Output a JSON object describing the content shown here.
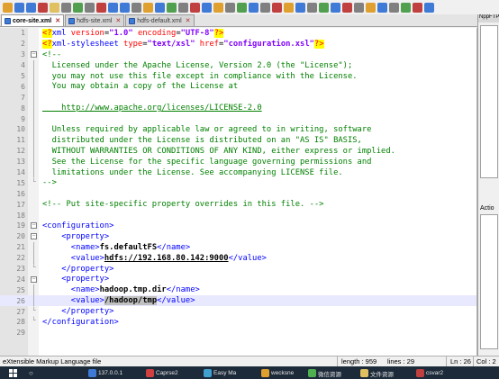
{
  "tabs": [
    {
      "label": "core-site.xml",
      "active": true
    },
    {
      "label": "hdfs-site.xml",
      "active": false
    },
    {
      "label": "hdfs-default.xml",
      "active": false
    }
  ],
  "right_panel": {
    "title": "NppFTP",
    "action_label": "Actio"
  },
  "editor": {
    "current_line": 26,
    "lines": [
      {
        "n": "1",
        "fold": "",
        "html": "<span class=\"pi\">&lt;?</span><span class=\"tag\">xml</span> <span class=\"attr\">version</span>=<span class=\"str\">\"1.0\"</span> <span class=\"attr\">encoding</span>=<span class=\"str\">\"UTF-8\"</span><span class=\"pi\">?&gt;</span>"
      },
      {
        "n": "2",
        "fold": "",
        "html": "<span class=\"pi\">&lt;?</span><span class=\"tag\">xml-stylesheet</span> <span class=\"attr\">type</span>=<span class=\"str\">\"text/xsl\"</span> <span class=\"attr\">href</span>=<span class=\"str\">\"configuration.xsl\"</span><span class=\"pi\">?&gt;</span>"
      },
      {
        "n": "3",
        "fold": "box",
        "html": "<span class=\"cmt\">&lt;!--</span>"
      },
      {
        "n": "4",
        "fold": "bar",
        "html": "<span class=\"cmt\">  Licensed under the Apache License, Version 2.0 (the \"License\");</span>"
      },
      {
        "n": "5",
        "fold": "bar",
        "html": "<span class=\"cmt\">  you may not use this file except in compliance with the License.</span>"
      },
      {
        "n": "6",
        "fold": "bar",
        "html": "<span class=\"cmt\">  You may obtain a copy of the License at</span>"
      },
      {
        "n": "7",
        "fold": "bar",
        "html": ""
      },
      {
        "n": "8",
        "fold": "bar",
        "html": "<span class=\"url\">    http://www.apache.org/licenses/LICENSE-2.0</span>"
      },
      {
        "n": "9",
        "fold": "bar",
        "html": ""
      },
      {
        "n": "10",
        "fold": "bar",
        "html": "<span class=\"cmt\">  Unless required by applicable law or agreed to in writing, software</span>"
      },
      {
        "n": "11",
        "fold": "bar",
        "html": "<span class=\"cmt\">  distributed under the License is distributed on an \"AS IS\" BASIS,</span>"
      },
      {
        "n": "12",
        "fold": "bar",
        "html": "<span class=\"cmt\">  WITHOUT WARRANTIES OR CONDITIONS OF ANY KIND, either express or implied.</span>"
      },
      {
        "n": "13",
        "fold": "bar",
        "html": "<span class=\"cmt\">  See the License for the specific language governing permissions and</span>"
      },
      {
        "n": "14",
        "fold": "bar",
        "html": "<span class=\"cmt\">  limitations under the License. See accompanying LICENSE file.</span>"
      },
      {
        "n": "15",
        "fold": "end",
        "html": "<span class=\"cmt\">--&gt;</span>"
      },
      {
        "n": "16",
        "fold": "",
        "html": ""
      },
      {
        "n": "17",
        "fold": "",
        "html": "<span class=\"cmt\">&lt;!-- Put site-specific property overrides in this file. --&gt;</span>"
      },
      {
        "n": "18",
        "fold": "",
        "html": ""
      },
      {
        "n": "19",
        "fold": "box",
        "html": "<span class=\"tag\">&lt;configuration&gt;</span>"
      },
      {
        "n": "20",
        "fold": "box",
        "html": "    <span class=\"tag\">&lt;property&gt;</span>"
      },
      {
        "n": "21",
        "fold": "bar",
        "html": "      <span class=\"tag\">&lt;name&gt;</span><span class=\"bold\">fs.defaultFS</span><span class=\"tag\">&lt;/name&gt;</span>"
      },
      {
        "n": "22",
        "fold": "bar",
        "html": "      <span class=\"tag\">&lt;value&gt;</span><span class=\"bold\" style=\"text-decoration:underline\">hdfs://192.168.80.142:9000</span><span class=\"tag\">&lt;/value&gt;</span>"
      },
      {
        "n": "23",
        "fold": "end",
        "html": "    <span class=\"tag\">&lt;/property&gt;</span>"
      },
      {
        "n": "24",
        "fold": "box",
        "html": "    <span class=\"tag\">&lt;property&gt;</span>"
      },
      {
        "n": "25",
        "fold": "bar",
        "html": "      <span class=\"tag\">&lt;name&gt;</span><span class=\"bold\">hadoop.tmp.dir</span><span class=\"tag\">&lt;/name&gt;</span>"
      },
      {
        "n": "26",
        "fold": "bar",
        "html": "      <span class=\"tag\">&lt;value&gt;</span><span class=\"bold sel\">/hadoop/tmp</span><span class=\"tag\">&lt;/value&gt;</span>"
      },
      {
        "n": "27",
        "fold": "end",
        "html": "    <span class=\"tag\">&lt;/property&gt;</span>"
      },
      {
        "n": "28",
        "fold": "end",
        "html": "<span class=\"tag\">&lt;/configuration&gt;</span>"
      },
      {
        "n": "29",
        "fold": "",
        "html": ""
      }
    ]
  },
  "status": {
    "file_type": "eXtensible Markup Language file",
    "length": "length : 959",
    "lines": "lines : 29",
    "ln": "Ln : 26",
    "col": "Col : 2"
  },
  "taskbar": {
    "items": [
      "137.0.0.1",
      "Caprse2",
      "Easy Ma",
      "wecksne",
      "微信资源",
      "文件资源",
      "csvar2"
    ]
  },
  "colors": {
    "tag": "#0000ff",
    "attr": "#ff0000",
    "string": "#8000ff",
    "comment": "#008000",
    "pi_bg": "#ffff00",
    "current_line": "#e8e8ff"
  }
}
